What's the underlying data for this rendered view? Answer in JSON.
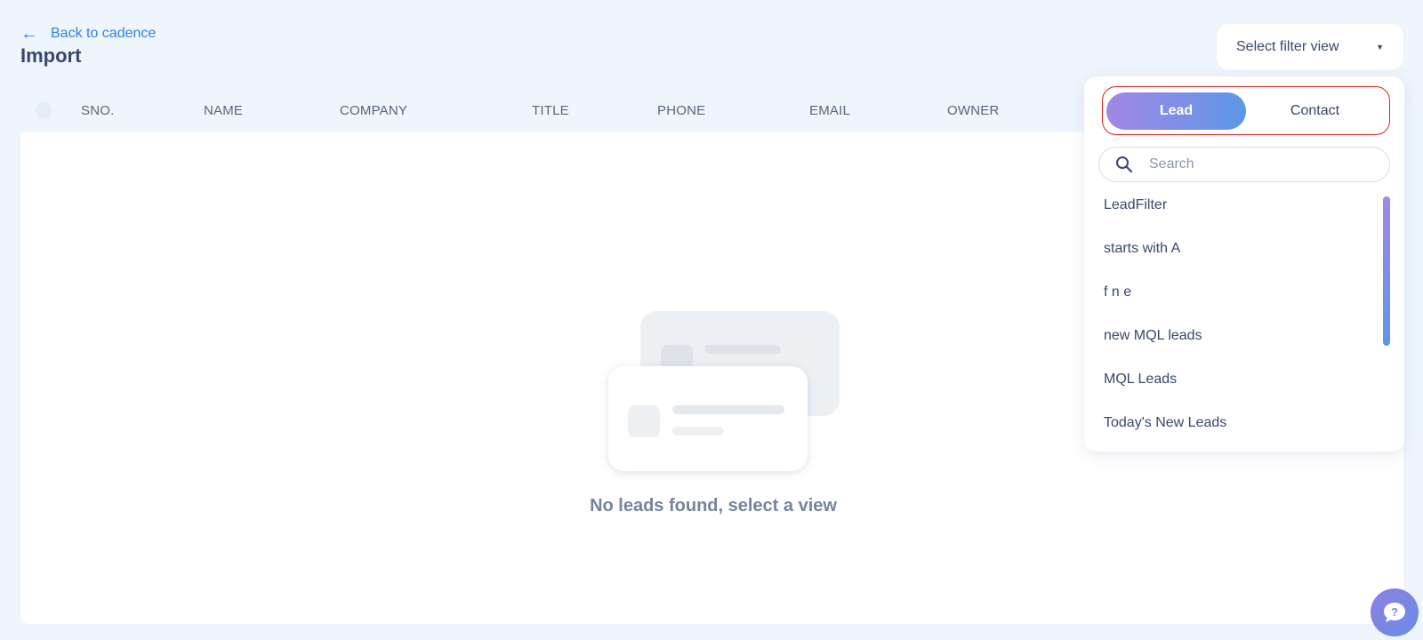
{
  "header": {
    "back_label": "Back to cadence",
    "title": "Import"
  },
  "filter_select": {
    "label": "Select filter view"
  },
  "table": {
    "columns": [
      "SNO.",
      "NAME",
      "COMPANY",
      "TITLE",
      "PHONE",
      "EMAIL",
      "OWNER"
    ]
  },
  "empty_state": {
    "message": "No leads found, select a view"
  },
  "dropdown": {
    "tabs": [
      {
        "label": "Lead",
        "active": true
      },
      {
        "label": "Contact",
        "active": false
      }
    ],
    "search_placeholder": "Search",
    "items": [
      "LeadFilter",
      "starts with A",
      "f n e",
      "new MQL leads",
      "MQL Leads",
      "Today's New Leads"
    ]
  },
  "colors": {
    "background": "#eef5fd",
    "accent": "#2f80ed",
    "toggle_gradient_start": "#a287e4",
    "toggle_gradient_end": "#5b98e8",
    "highlight_border": "#e02020"
  },
  "icons": {
    "back": "arrow-left-icon",
    "caret": "caret-down-icon",
    "search": "search-icon",
    "help": "chat-help-icon"
  }
}
